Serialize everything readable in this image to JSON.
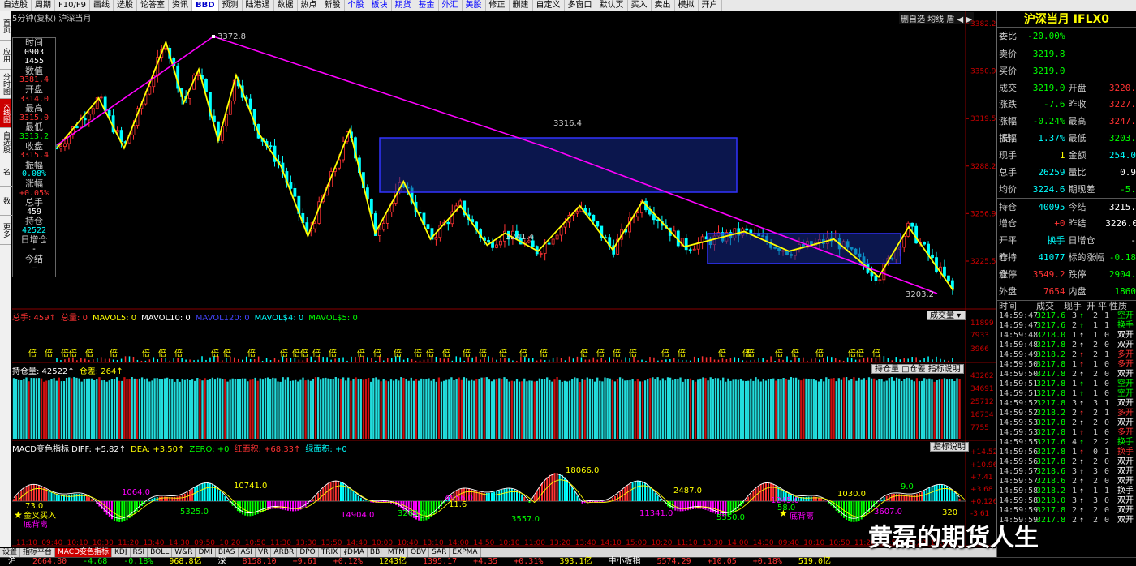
{
  "topbar": {
    "items": [
      "自选股",
      "周期",
      "F10/F9",
      "画线",
      "选股",
      "论答室",
      "资讯",
      "BBD",
      "预测",
      "陆港通",
      "数据",
      "热点",
      "新股",
      "个股",
      "板块",
      "期货",
      "基金",
      "外汇",
      "美股",
      "修正",
      "删建",
      "自定义",
      "多窗口",
      "默认页",
      "买入",
      "卖出",
      "模拟",
      "开户"
    ]
  },
  "leftnav": [
    "首页",
    "应用",
    "分时图",
    "K线图",
    "自选股",
    "综合排名",
    "上证指数",
    "更多"
  ],
  "chart": {
    "title": "5分钟(复权)  沪深当月",
    "buttons": "删自选  均线  盾  ◀ ▶",
    "price_ticks": [
      "3382.2",
      "3350.9",
      "3319.5",
      "3288.2",
      "3256.9",
      "3225.5"
    ],
    "annotations": {
      "hi": "3372.8",
      "p1": "3241.4",
      "p2": "3316.4",
      "lo": "3203.2"
    },
    "time_labels": [
      "11:10",
      "09:40",
      "10:10",
      "10:30",
      "11:20",
      "13:40",
      "14:30",
      "09:50",
      "10:20",
      "10:50",
      "11:30",
      "13:30",
      "13:50",
      "14:40",
      "10:00",
      "10:40",
      "13:10",
      "14:00",
      "14:50",
      "10:10",
      "11:00",
      "13:20",
      "13:40",
      "14:10",
      "15:00",
      "10:20",
      "11:10",
      "13:30",
      "14:00",
      "14:30",
      "09:40",
      "10:10",
      "10:50",
      "11:20",
      "13:50",
      "14:20",
      "15:00"
    ]
  },
  "infobox": [
    {
      "k": "时间",
      "v": "0903",
      "c": "wht"
    },
    {
      "k": "",
      "v": "1455",
      "c": "wht"
    },
    {
      "k": "数值",
      "v": "3381.4",
      "c": "red"
    },
    {
      "k": "开盘",
      "v": "3314.0",
      "c": "red"
    },
    {
      "k": "最高",
      "v": "3315.0",
      "c": "red"
    },
    {
      "k": "最低",
      "v": "3313.2",
      "c": "grn"
    },
    {
      "k": "收盘",
      "v": "3315.4",
      "c": "red"
    },
    {
      "k": "振幅",
      "v": "0.08%",
      "c": "cyn"
    },
    {
      "k": "涨幅",
      "v": "+0.05%",
      "c": "red"
    },
    {
      "k": "总手",
      "v": "459",
      "c": "wht"
    },
    {
      "k": "持仓",
      "v": "42522",
      "c": "cyn"
    },
    {
      "k": "日增仓",
      "v": "-",
      "c": "wht"
    },
    {
      "k": "今结",
      "v": "—",
      "c": "wht"
    }
  ],
  "volume": {
    "header": [
      {
        "t": "总手: 459↑",
        "c": "red"
      },
      {
        "t": "总量: 0",
        "c": "red"
      },
      {
        "t": "MAVOL5: 0",
        "c": "yel"
      },
      {
        "t": "MAVOL10: 0",
        "c": "wht"
      },
      {
        "t": "MAVOL120: 0",
        "c": "blu"
      },
      {
        "t": "MAVOL$4: 0",
        "c": "cyn"
      },
      {
        "t": "MAVOL$5: 0",
        "c": "grn"
      }
    ],
    "btn": "成交量",
    "ticks": [
      "11899",
      "7933",
      "3966"
    ],
    "mark_label": "倍"
  },
  "oi": {
    "header": [
      {
        "t": "持仓量: 42522↑",
        "c": "wht"
      },
      {
        "t": "仓差: 264↑",
        "c": "yel"
      }
    ],
    "btn": "持仓量 □仓差 指标说明",
    "ticks": [
      "43262",
      "34691",
      "25712",
      "16734",
      "7755"
    ]
  },
  "macd": {
    "header": [
      {
        "t": "MACD变色指标 DIFF: +5.82↑",
        "c": "wht"
      },
      {
        "t": "DEA: +3.50↑",
        "c": "yel"
      },
      {
        "t": "ZERO: +0",
        "c": "grn"
      },
      {
        "t": "红面积: +68.33↑",
        "c": "red"
      },
      {
        "t": "绿面积: +0",
        "c": "cyn"
      }
    ],
    "btn": "指标说明",
    "ticks": [
      "+14.52",
      "+10.96",
      "+7.41",
      "+3.68",
      "+0.126",
      "-3.61"
    ],
    "labels": [
      "73.0",
      "1064.0",
      "5325.0",
      "10741.0",
      "14904.0",
      "3263.0",
      "11.6",
      "4956.0",
      "3557.0",
      "18066.0",
      "11341.0",
      "5350.0",
      "2487.0",
      "1245.0",
      "58.0",
      "1030.0",
      "3607.0",
      "9.0",
      "320"
    ],
    "signal_labels": [
      "金叉买入",
      "底背离"
    ]
  },
  "bottombar": [
    "设置",
    "指标平台",
    "MACD变色指标",
    "KDJ",
    "RSI",
    "BOLL",
    "W&R",
    "DMI",
    "BIAS",
    "ASI",
    "VR",
    "ARBR",
    "DPO",
    "TRIX",
    "∮DMA",
    "BBI",
    "MTM",
    "OBV",
    "SAR",
    "EXPMA"
  ],
  "ticker": [
    {
      "t": "沪",
      "c": "wht"
    },
    {
      "t": "2664.80",
      "c": "red"
    },
    {
      "t": "-4.68",
      "c": "grn"
    },
    {
      "t": "-0.18%",
      "c": "grn"
    },
    {
      "t": "968.8亿",
      "c": "yel"
    },
    {
      "t": "深",
      "c": "wht"
    },
    {
      "t": "8158.10",
      "c": "red"
    },
    {
      "t": "+9.61",
      "c": "red"
    },
    {
      "t": "+0.12%",
      "c": "red"
    },
    {
      "t": "1243亿",
      "c": "yel"
    },
    {
      "t": "1395.17",
      "c": "red"
    },
    {
      "t": "+4.35",
      "c": "red"
    },
    {
      "t": "+0.31%",
      "c": "red"
    },
    {
      "t": "393.1亿",
      "c": "yel"
    },
    {
      "t": "中小板指",
      "c": "wht"
    },
    {
      "t": "5574.29",
      "c": "red"
    },
    {
      "t": "+10.05",
      "c": "red"
    },
    {
      "t": "+0.18%",
      "c": "red"
    },
    {
      "t": "519.0亿",
      "c": "yel"
    }
  ],
  "rpanel": {
    "title": "沪深当月 IFLX0",
    "rows": [
      {
        "l": "委比",
        "v1": "-20.00%",
        "c1": "grn",
        "l2": "",
        "v2": "",
        "c2": "wht"
      },
      {
        "l": "卖价",
        "v1": "3219.8",
        "c1": "grn",
        "l2": "",
        "v2": "",
        "c2": "wht",
        "sep": 1
      },
      {
        "l": "买价",
        "v1": "3219.0",
        "c1": "grn",
        "l2": "",
        "v2": "",
        "c2": "wht",
        "sep": 1
      },
      {
        "l": "成交",
        "v1": "3219.0",
        "c1": "grn",
        "l2": "开盘",
        "v2": "3220.",
        "c2": "red",
        "sep": 1
      },
      {
        "l": "涨跌",
        "v1": "-7.6",
        "c1": "grn",
        "l2": "昨收",
        "v2": "3227.",
        "c2": "red"
      },
      {
        "l": "涨幅(结)",
        "v1": "-0.24%",
        "c1": "grn",
        "l2": "最高",
        "v2": "3247.",
        "c2": "red"
      },
      {
        "l": "振幅",
        "v1": "1.37%",
        "c1": "cyn",
        "l2": "最低",
        "v2": "3203.",
        "c2": "grn"
      },
      {
        "l": "现手",
        "v1": "1",
        "c1": "yel",
        "l2": "金额",
        "v2": "254.0",
        "c2": "cyn"
      },
      {
        "l": "总手",
        "v1": "26259",
        "c1": "cyn",
        "l2": "量比",
        "v2": "0.9",
        "c2": "wht"
      },
      {
        "l": "均价",
        "v1": "3224.6",
        "c1": "cyn",
        "l2": "期现差",
        "v2": "-5.",
        "c2": "grn"
      },
      {
        "l": "持仓",
        "v1": "40095",
        "c1": "cyn",
        "l2": "今结",
        "v2": "3215.",
        "c2": "wht",
        "sep": 1
      },
      {
        "l": "增仓",
        "v1": "+0",
        "c1": "red",
        "l2": "昨结",
        "v2": "3226.0",
        "c2": "wht"
      },
      {
        "l": "开平仓",
        "v1": "换手",
        "c1": "cyn",
        "l2": "日增仓",
        "v2": "-",
        "c2": "wht"
      },
      {
        "l": "昨持仓",
        "v1": "41077",
        "c1": "cyn",
        "l2": "标的涨幅",
        "v2": "-0.18",
        "c2": "grn"
      },
      {
        "l": "涨停",
        "v1": "3549.2",
        "c1": "red",
        "l2": "跌停",
        "v2": "2904.",
        "c2": "grn"
      },
      {
        "l": "外盘",
        "v1": "7654",
        "c1": "red",
        "l2": "内盘",
        "v2": "1860",
        "c2": "grn"
      }
    ],
    "tick_header": [
      "时间",
      "成交",
      "现手",
      "开",
      "平",
      "性质"
    ],
    "ticks": [
      {
        "t": "14:59:47",
        "p": "3217.6",
        "q": "3",
        "a": "↑",
        "ac": "grn",
        "o": "2",
        "c": "1",
        "n": "空开",
        "nc": "grn"
      },
      {
        "t": "14:59:47",
        "p": "3217.6",
        "q": "2",
        "a": "↑",
        "ac": "grn",
        "o": "1",
        "c": "1",
        "n": "换手",
        "nc": "grn"
      },
      {
        "t": "14:59:48",
        "p": "3218.0",
        "q": "1",
        "a": "↑",
        "ac": "wht",
        "o": "1",
        "c": "0",
        "n": "双开",
        "nc": "wht"
      },
      {
        "t": "14:59:48",
        "p": "3217.8",
        "q": "2",
        "a": "↑",
        "ac": "wht",
        "o": "2",
        "c": "0",
        "n": "双开",
        "nc": "wht"
      },
      {
        "t": "14:59:49",
        "p": "3218.2",
        "q": "2",
        "a": "↑",
        "ac": "red",
        "o": "2",
        "c": "1",
        "n": "多开",
        "nc": "red"
      },
      {
        "t": "14:59:50",
        "p": "3217.8",
        "q": "1",
        "a": "↑",
        "ac": "red",
        "o": "1",
        "c": "0",
        "n": "多开",
        "nc": "red"
      },
      {
        "t": "14:59:50",
        "p": "3217.8",
        "q": "2",
        "a": "↑",
        "ac": "wht",
        "o": "2",
        "c": "0",
        "n": "双开",
        "nc": "wht"
      },
      {
        "t": "14:59:51",
        "p": "3217.8",
        "q": "1",
        "a": "↑",
        "ac": "grn",
        "o": "1",
        "c": "0",
        "n": "空开",
        "nc": "grn"
      },
      {
        "t": "14:59:51",
        "p": "3217.8",
        "q": "1",
        "a": "↑",
        "ac": "grn",
        "o": "1",
        "c": "0",
        "n": "空开",
        "nc": "grn"
      },
      {
        "t": "14:59:52",
        "p": "3217.8",
        "q": "3",
        "a": "↑",
        "ac": "wht",
        "o": "3",
        "c": "1",
        "n": "双开",
        "nc": "wht"
      },
      {
        "t": "14:59:52",
        "p": "3218.2",
        "q": "2",
        "a": "↑",
        "ac": "red",
        "o": "2",
        "c": "1",
        "n": "多开",
        "nc": "red"
      },
      {
        "t": "14:59:53",
        "p": "3217.8",
        "q": "2",
        "a": "↑",
        "ac": "wht",
        "o": "2",
        "c": "0",
        "n": "双开",
        "nc": "wht"
      },
      {
        "t": "14:59:53",
        "p": "3217.8",
        "q": "1",
        "a": "↑",
        "ac": "red",
        "o": "1",
        "c": "0",
        "n": "多开",
        "nc": "red"
      },
      {
        "t": "14:59:55",
        "p": "3217.6",
        "q": "4",
        "a": "↑",
        "ac": "grn",
        "o": "2",
        "c": "2",
        "n": "换手",
        "nc": "grn"
      },
      {
        "t": "14:59:56",
        "p": "3217.8",
        "q": "1",
        "a": "↑",
        "ac": "red",
        "o": "0",
        "c": "1",
        "n": "换手",
        "nc": "red"
      },
      {
        "t": "14:59:56",
        "p": "3217.8",
        "q": "2",
        "a": "↑",
        "ac": "wht",
        "o": "2",
        "c": "0",
        "n": "双开",
        "nc": "wht"
      },
      {
        "t": "14:59:57",
        "p": "3218.6",
        "q": "3",
        "a": "↑",
        "ac": "wht",
        "o": "3",
        "c": "0",
        "n": "双开",
        "nc": "wht"
      },
      {
        "t": "14:59:57",
        "p": "3218.6",
        "q": "2",
        "a": "↑",
        "ac": "wht",
        "o": "2",
        "c": "0",
        "n": "双开",
        "nc": "wht"
      },
      {
        "t": "14:59:58",
        "p": "3218.2",
        "q": "1",
        "a": "↑",
        "ac": "wht",
        "o": "1",
        "c": "1",
        "n": "换手",
        "nc": "wht"
      },
      {
        "t": "14:59:58",
        "p": "3218.0",
        "q": "3",
        "a": "↑",
        "ac": "wht",
        "o": "3",
        "c": "0",
        "n": "双开",
        "nc": "wht"
      },
      {
        "t": "14:59:59",
        "p": "3217.8",
        "q": "2",
        "a": "↑",
        "ac": "wht",
        "o": "2",
        "c": "0",
        "n": "双开",
        "nc": "wht"
      },
      {
        "t": "14:59:59",
        "p": "3217.8",
        "q": "2",
        "a": "↑",
        "ac": "wht",
        "o": "2",
        "c": "0",
        "n": "双开",
        "nc": "wht"
      }
    ]
  },
  "watermark": "黄磊的期货人生"
}
